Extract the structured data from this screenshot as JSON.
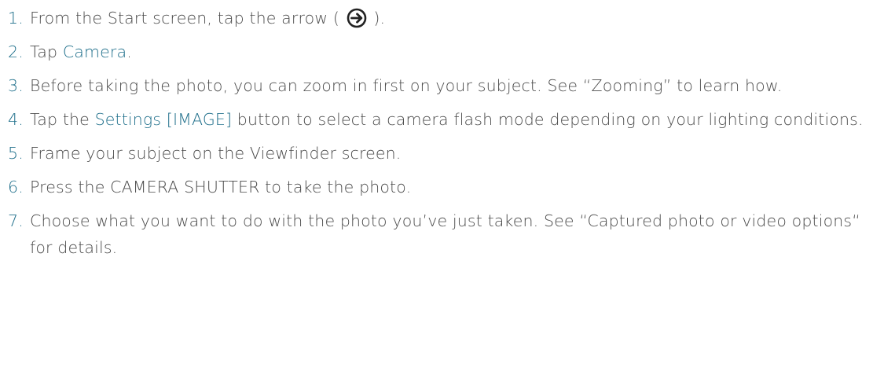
{
  "steps": [
    {
      "number": "1.",
      "before": "From the Start screen, tap the arrow (",
      "after": ")."
    },
    {
      "number": "2.",
      "before": "Tap ",
      "term": "Camera",
      "after": "."
    },
    {
      "number": "3.",
      "text": "Before taking the photo, you can zoom in first on your subject. See “Zooming” to learn how."
    },
    {
      "number": "4.",
      "before": "Tap the ",
      "term": "Settings [IMAGE]",
      "after": " button to select a camera flash mode depending on your lighting conditions."
    },
    {
      "number": "5.",
      "text": "Frame your subject on the Viewfinder screen."
    },
    {
      "number": "6.",
      "text": "Press the CAMERA SHUTTER to take the photo."
    },
    {
      "number": "7.",
      "text": "Choose what you want to do with the photo you’ve just taken. See “Captured photo or video options“ for details."
    }
  ],
  "icons": {
    "arrow": "arrow-circle-right-icon"
  },
  "colors": {
    "text": "#4a4a4a",
    "accent": "#1f6f8b"
  }
}
